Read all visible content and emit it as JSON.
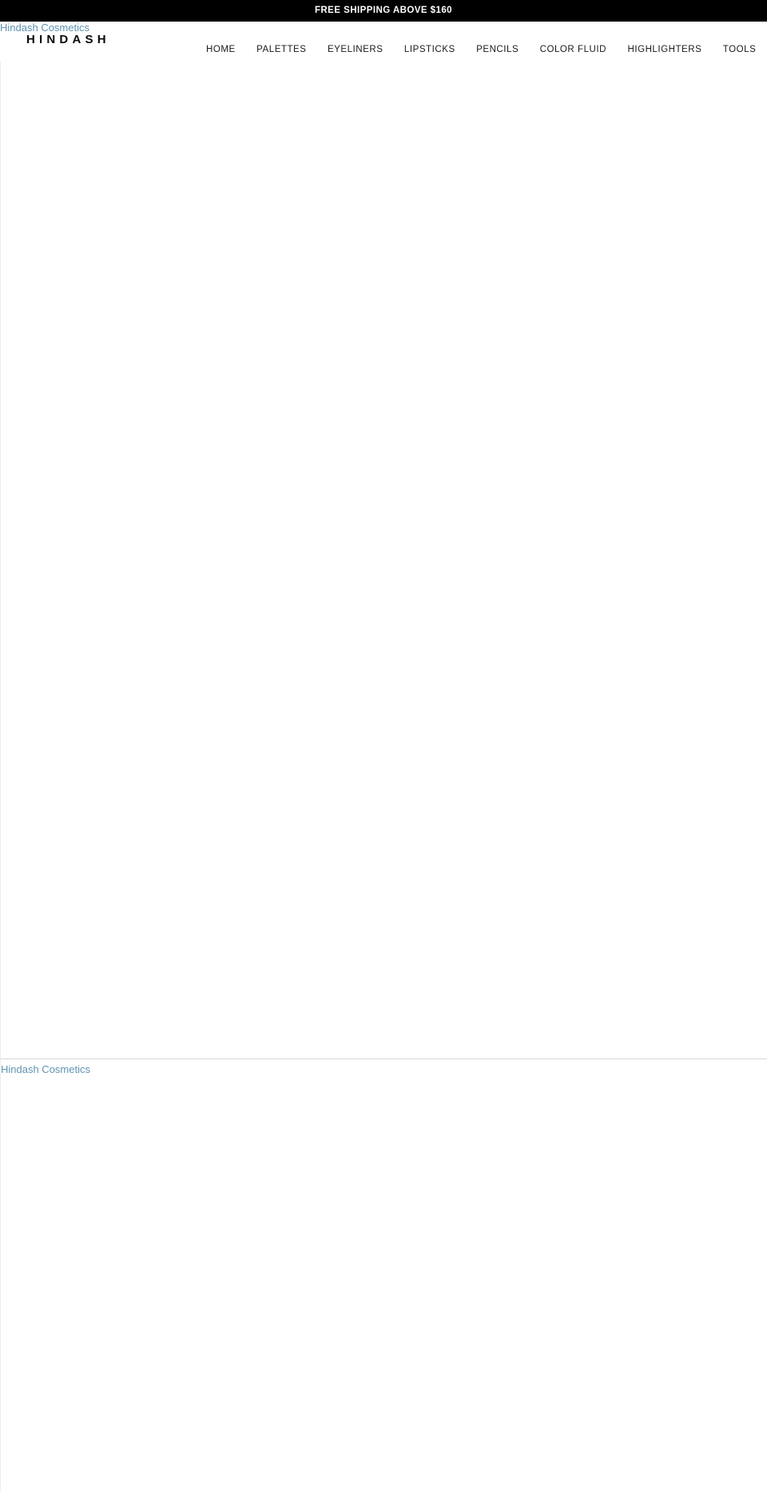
{
  "promo": {
    "text": "FREE SHIPPING ABOVE $160"
  },
  "header": {
    "logo_alt": "Hindash Cosmetics",
    "wordmark": "HINDASH",
    "nav": [
      {
        "label": "HOME"
      },
      {
        "label": "PALETTES"
      },
      {
        "label": "EYELINERS"
      },
      {
        "label": "LIPSTICKS"
      },
      {
        "label": "PENCILS"
      },
      {
        "label": "COLOR FLUID"
      },
      {
        "label": "HIGHLIGHTERS"
      },
      {
        "label": "TOOLS"
      }
    ]
  },
  "footer": {
    "logo_alt": "Hindash Cosmetics"
  },
  "colors": {
    "promo_background": "#000000",
    "promo_text": "#ffffff",
    "page_background": "#ffffff",
    "broken_image_alt_text": "#5f94b2",
    "nav_text": "#1a1a1a",
    "divider": "#d6d6d6"
  }
}
